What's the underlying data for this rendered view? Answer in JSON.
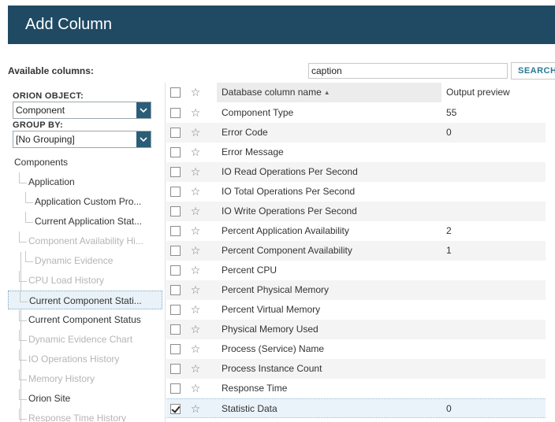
{
  "dialog": {
    "title": "Add Column"
  },
  "available_label": "Available columns:",
  "search": {
    "value": "caption",
    "button_label": "SEARCH"
  },
  "left": {
    "orion_object_label": "ORION OBJECT:",
    "orion_object_value": "Component",
    "group_by_label": "GROUP BY:",
    "group_by_value": "[No Grouping]",
    "tree": [
      {
        "label": "Components",
        "state": "normal"
      },
      {
        "label": "Application",
        "state": "normal"
      },
      {
        "label": "Application Custom Pro...",
        "state": "normal"
      },
      {
        "label": "Current Application Stat...",
        "state": "normal"
      },
      {
        "label": "Component Availability Hi...",
        "state": "muted"
      },
      {
        "label": "Dynamic Evidence",
        "state": "muted"
      },
      {
        "label": "CPU Load History",
        "state": "muted"
      },
      {
        "label": "Current Component Stati...",
        "state": "selected"
      },
      {
        "label": "Current Component Status",
        "state": "normal"
      },
      {
        "label": "Dynamic Evidence Chart",
        "state": "muted"
      },
      {
        "label": "IO Operations History",
        "state": "muted"
      },
      {
        "label": "Memory History",
        "state": "muted"
      },
      {
        "label": "Orion Site",
        "state": "normal"
      },
      {
        "label": "Response Time History",
        "state": "muted"
      }
    ]
  },
  "grid": {
    "headers": {
      "name": "Database column name",
      "preview": "Output preview"
    },
    "rows": [
      {
        "name": "Component Type",
        "preview": "55",
        "checked": false
      },
      {
        "name": "Error Code",
        "preview": "0",
        "checked": false
      },
      {
        "name": "Error Message",
        "preview": "",
        "checked": false
      },
      {
        "name": "IO Read Operations Per Second",
        "preview": "",
        "checked": false
      },
      {
        "name": "IO Total Operations Per Second",
        "preview": "",
        "checked": false
      },
      {
        "name": "IO Write Operations Per Second",
        "preview": "",
        "checked": false
      },
      {
        "name": "Percent Application Availability",
        "preview": "2",
        "checked": false
      },
      {
        "name": "Percent Component Availability",
        "preview": "1",
        "checked": false
      },
      {
        "name": "Percent CPU",
        "preview": "",
        "checked": false
      },
      {
        "name": "Percent Physical Memory",
        "preview": "",
        "checked": false
      },
      {
        "name": "Percent Virtual Memory",
        "preview": "",
        "checked": false
      },
      {
        "name": "Physical Memory Used",
        "preview": "",
        "checked": false
      },
      {
        "name": "Process (Service) Name",
        "preview": "",
        "checked": false
      },
      {
        "name": "Process Instance Count",
        "preview": "",
        "checked": false
      },
      {
        "name": "Response Time",
        "preview": "",
        "checked": false
      },
      {
        "name": "Statistic Data",
        "preview": "0",
        "checked": true
      }
    ]
  },
  "colors": {
    "title_bar": "#204a63",
    "accent": "#297994",
    "dropdown": "#2a5d77"
  }
}
